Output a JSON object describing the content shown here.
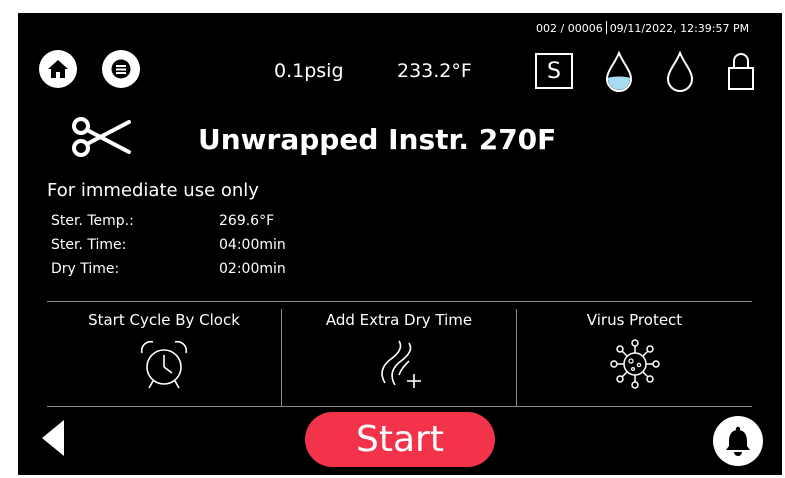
{
  "status": {
    "counter": "002 / 00006",
    "datetime": "09/11/2022, 12:39:57 PM"
  },
  "header": {
    "pressure": "0.1psig",
    "temperature": "233.2°F",
    "s_label": "S",
    "icons": [
      "home-icon",
      "menu-icon",
      "water-drop-filled-icon",
      "water-drop-outline-icon",
      "lock-icon"
    ]
  },
  "program": {
    "icon": "scissors-icon",
    "title": "Unwrapped Instr. 270F",
    "subtitle": "For immediate use only",
    "params": [
      {
        "label": "Ster. Temp.:",
        "value": "269.6°F"
      },
      {
        "label": "Ster. Time:",
        "value": "04:00min"
      },
      {
        "label": "Dry Time:",
        "value": "02:00min"
      }
    ]
  },
  "options": [
    {
      "label": "Start Cycle By Clock",
      "icon": "alarm-clock-icon"
    },
    {
      "label": "Add Extra Dry Time",
      "icon": "extra-dry-time-icon"
    },
    {
      "label": "Virus Protect",
      "icon": "virus-icon"
    }
  ],
  "footer": {
    "start_label": "Start",
    "icons": [
      "back-arrow-icon",
      "bell-icon"
    ]
  },
  "colors": {
    "background": "#000000",
    "start_button": "#f2334a",
    "drop_fill": "#a9dcf2",
    "divider": "#8a8a8a"
  }
}
